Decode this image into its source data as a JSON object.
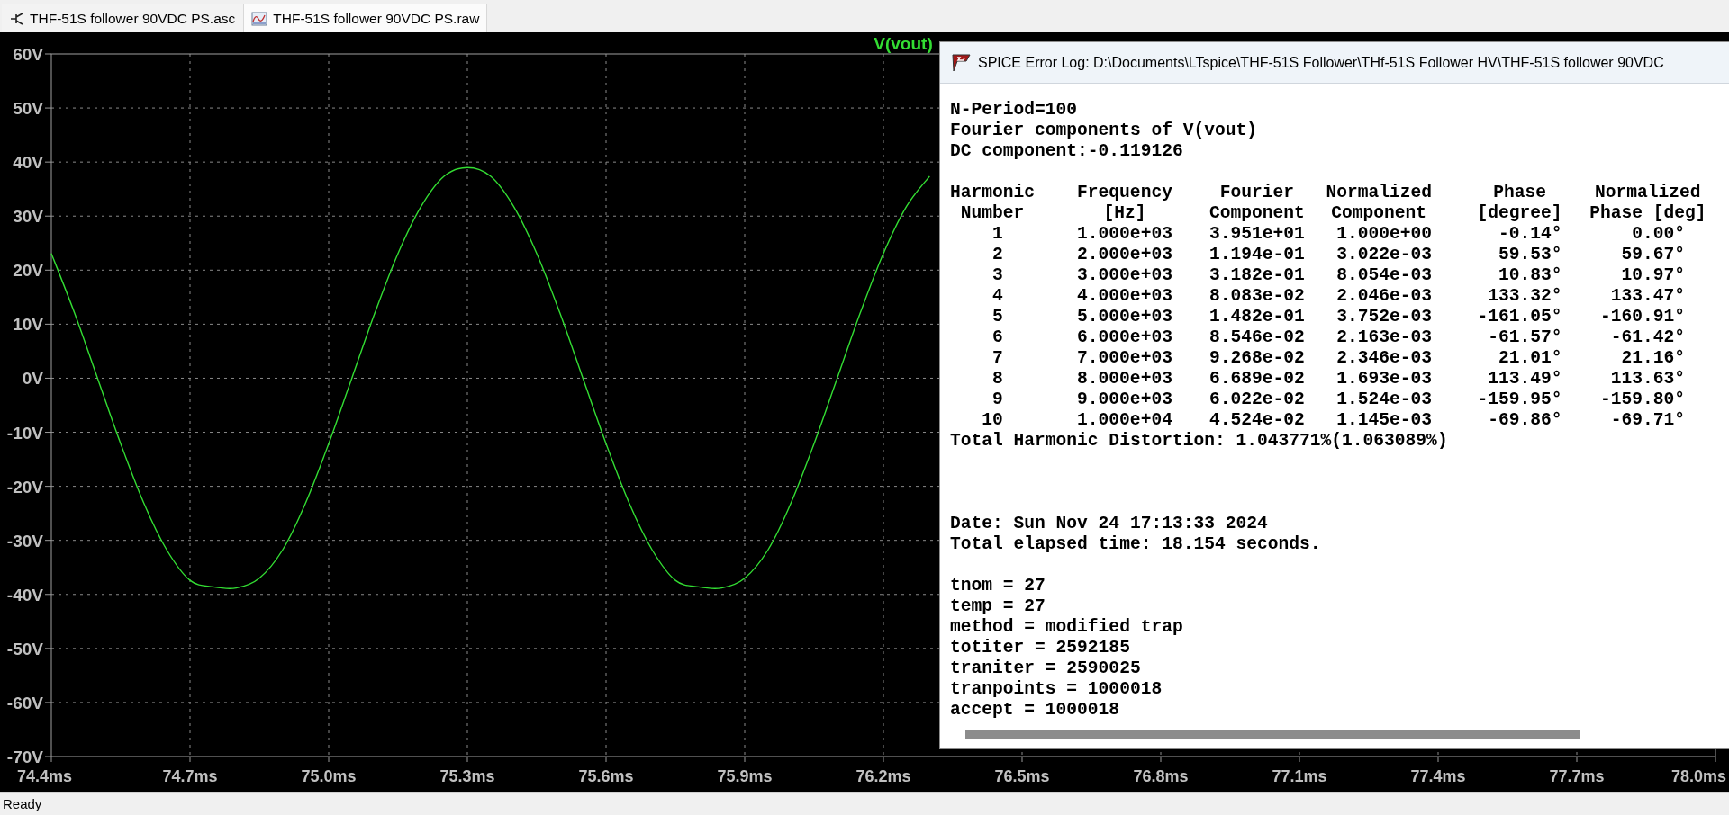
{
  "tabs": [
    {
      "label": "THF-51S follower 90VDC PS.asc",
      "kind": "schematic",
      "selected": false
    },
    {
      "label": "THF-51S follower 90VDC PS.raw",
      "kind": "waveform",
      "selected": true
    }
  ],
  "plot": {
    "chart_data": {
      "type": "line",
      "x": [
        74.4,
        74.45,
        74.5,
        74.55,
        74.6,
        74.65,
        74.7,
        74.75,
        74.8,
        74.85,
        74.9,
        74.95,
        75.0,
        75.05,
        75.1,
        75.15,
        75.2,
        75.25,
        75.3,
        75.35,
        75.4,
        75.45,
        75.5,
        75.55,
        75.6,
        75.65,
        75.7,
        75.75,
        75.8,
        75.85,
        75.9,
        75.95,
        76.0,
        76.05,
        76.1,
        76.15,
        76.2,
        76.25,
        76.3
      ],
      "series": [
        {
          "name": "V(vout)",
          "color": "#33dd33",
          "values": [
            23.1,
            12.1,
            0,
            -12.1,
            -23.1,
            -31.8,
            -37.4,
            -38.6,
            -38.8,
            -37.0,
            -31.8,
            -23.1,
            -12.1,
            0,
            12.1,
            23.1,
            31.8,
            37.4,
            39.0,
            37.4,
            31.8,
            23.1,
            12.1,
            0,
            -12.1,
            -23.1,
            -31.8,
            -37.4,
            -38.6,
            -38.8,
            -37.0,
            -31.8,
            -23.1,
            -12.1,
            0,
            12.1,
            23.1,
            31.8,
            37.4
          ]
        }
      ],
      "grid": true,
      "xlim": [
        74.4,
        78.0
      ],
      "ylim": [
        -70,
        60
      ],
      "xticks": [
        {
          "value": 74.4,
          "label": "74.4ms"
        },
        {
          "value": 74.7,
          "label": "74.7ms"
        },
        {
          "value": 75.0,
          "label": "75.0ms"
        },
        {
          "value": 75.3,
          "label": "75.3ms"
        },
        {
          "value": 75.6,
          "label": "75.6ms"
        },
        {
          "value": 75.9,
          "label": "75.9ms"
        },
        {
          "value": 76.2,
          "label": "76.2ms"
        },
        {
          "value": 76.5,
          "label": "76.5ms"
        },
        {
          "value": 76.8,
          "label": "76.8ms"
        },
        {
          "value": 77.1,
          "label": "77.1ms"
        },
        {
          "value": 77.4,
          "label": "77.4ms"
        },
        {
          "value": 77.7,
          "label": "77.7ms"
        },
        {
          "value": 78.0,
          "label": "78.0ms"
        }
      ],
      "yticks": [
        {
          "value": 60,
          "label": "60V"
        },
        {
          "value": 50,
          "label": "50V"
        },
        {
          "value": 40,
          "label": "40V"
        },
        {
          "value": 30,
          "label": "30V"
        },
        {
          "value": 20,
          "label": "20V"
        },
        {
          "value": 10,
          "label": "10V"
        },
        {
          "value": 0,
          "label": "0V"
        },
        {
          "value": -10,
          "label": "-10V"
        },
        {
          "value": -20,
          "label": "-20V"
        },
        {
          "value": -30,
          "label": "-30V"
        },
        {
          "value": -40,
          "label": "-40V"
        },
        {
          "value": -50,
          "label": "-50V"
        },
        {
          "value": -60,
          "label": "-60V"
        },
        {
          "value": -70,
          "label": "-70V"
        }
      ]
    }
  },
  "error_log": {
    "title": "SPICE Error Log: D:\\Documents\\LTspice\\THF-51S Follower\\THf-51S Follower HV\\THF-51S follower 90VDC",
    "header_lines": [
      "N-Period=100",
      "Fourier components of V(vout)",
      "DC component:-0.119126"
    ],
    "fourier_table": {
      "columns": [
        {
          "label": "Harmonic",
          "sublabel": "Number"
        },
        {
          "label": "Frequency",
          "sublabel": "[Hz]"
        },
        {
          "label": "Fourier",
          "sublabel": "Component"
        },
        {
          "label": "Normalized",
          "sublabel": "Component"
        },
        {
          "label": "Phase",
          "sublabel": "[degree]"
        },
        {
          "label": "Normalized",
          "sublabel": "Phase [deg]"
        }
      ],
      "rows": [
        [
          "1",
          "1.000e+03",
          "3.951e+01",
          "1.000e+00",
          "-0.14°",
          "0.00°"
        ],
        [
          "2",
          "2.000e+03",
          "1.194e-01",
          "3.022e-03",
          "59.53°",
          "59.67°"
        ],
        [
          "3",
          "3.000e+03",
          "3.182e-01",
          "8.054e-03",
          "10.83°",
          "10.97°"
        ],
        [
          "4",
          "4.000e+03",
          "8.083e-02",
          "2.046e-03",
          "133.32°",
          "133.47°"
        ],
        [
          "5",
          "5.000e+03",
          "1.482e-01",
          "3.752e-03",
          "-161.05°",
          "-160.91°"
        ],
        [
          "6",
          "6.000e+03",
          "8.546e-02",
          "2.163e-03",
          "-61.57°",
          "-61.42°"
        ],
        [
          "7",
          "7.000e+03",
          "9.268e-02",
          "2.346e-03",
          "21.01°",
          "21.16°"
        ],
        [
          "8",
          "8.000e+03",
          "6.689e-02",
          "1.693e-03",
          "113.49°",
          "113.63°"
        ],
        [
          "9",
          "9.000e+03",
          "6.022e-02",
          "1.524e-03",
          "-159.95°",
          "-159.80°"
        ],
        [
          "10",
          "1.000e+04",
          "4.524e-02",
          "1.145e-03",
          "-69.86°",
          "-69.71°"
        ]
      ]
    },
    "thd": "Total Harmonic Distortion: 1.043771%(1.063089%)",
    "time_lines": [
      "Date: Sun Nov 24 17:13:33 2024",
      "Total elapsed time: 18.154 seconds."
    ],
    "option_lines": [
      "tnom = 27",
      "temp = 27",
      "method = modified trap",
      "totiter = 2592185",
      "traniter = 2590025",
      "tranpoints = 1000018",
      "accept = 1000018"
    ]
  },
  "status_bar": {
    "text": "Ready"
  }
}
